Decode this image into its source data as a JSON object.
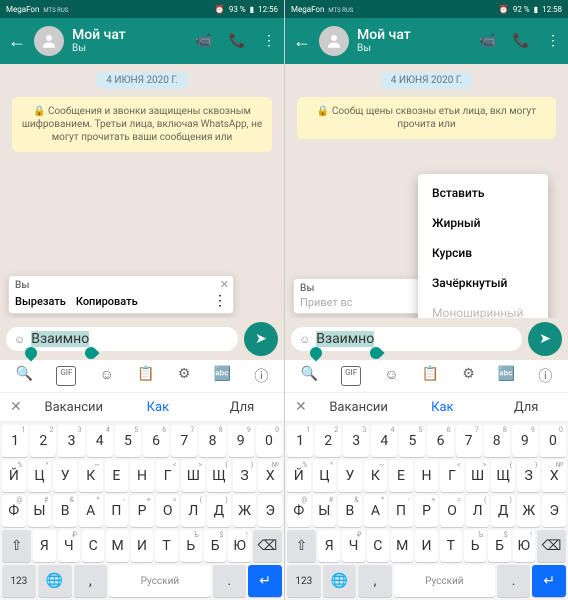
{
  "left": {
    "status": {
      "carrier": "MegaFon",
      "sub": "MTS RUS",
      "battery": "93 %",
      "time": "12:56"
    },
    "header": {
      "title": "Мой чат",
      "sub": "Вы"
    },
    "date": "4 ИЮНЯ 2020 Г.",
    "enc": "🔒 Сообщения и звонки защищены сквозным шифрованием. Третьи лица, включая WhatsApp, не могут прочитать ваши сообщения или",
    "reply": {
      "who": "Вы",
      "cut": "Вырезать",
      "copy": "Копировать"
    },
    "input": "Взаимно"
  },
  "right": {
    "status": {
      "carrier": "MegaFon",
      "sub": "MTS RUS",
      "battery": "92 %",
      "time": "12:58"
    },
    "header": {
      "title": "Мой чат",
      "sub": "Вы"
    },
    "date": "4 ИЮНЯ 2020 Г.",
    "enc": "🔒 Сообщ                               щены сквозны                          етьи лица, вкл                           могут прочита                          или",
    "menu": [
      "Вставить",
      "Жирный",
      "Курсив",
      "Зачёркнутый",
      "Моноширинный"
    ],
    "reply": {
      "who": "Вы",
      "ghost": "Привет вс"
    },
    "input": "Взаимно"
  },
  "suggest": {
    "s1": "Вакансии",
    "s2": "Как",
    "s3": "Для"
  },
  "keyboard": {
    "numrow": [
      [
        "1",
        "1"
      ],
      [
        "2",
        "2"
      ],
      [
        "3",
        "3"
      ],
      [
        "4",
        "4"
      ],
      [
        "5",
        "5"
      ],
      [
        "6",
        "6"
      ],
      [
        "7",
        "7"
      ],
      [
        "8",
        "8"
      ],
      [
        "9",
        "9"
      ],
      [
        "0",
        "0"
      ]
    ],
    "row1": [
      [
        "Й",
        "%"
      ],
      [
        "Ц",
        "^"
      ],
      [
        "У",
        ""
      ],
      [
        "К",
        "~"
      ],
      [
        "Е",
        ""
      ],
      [
        "Н",
        ""
      ],
      [
        "Г",
        "<"
      ],
      [
        "Ш",
        ">"
      ],
      [
        "Щ",
        "{"
      ],
      [
        "З",
        "}"
      ],
      [
        "Х",
        "№"
      ]
    ],
    "row2": [
      [
        "Ф",
        "@"
      ],
      [
        "Ы",
        "#"
      ],
      [
        "В",
        "&"
      ],
      [
        "А",
        "*"
      ],
      [
        "П",
        "-"
      ],
      [
        "Р",
        "+"
      ],
      [
        "О",
        "="
      ],
      [
        "Л",
        "("
      ],
      [
        "Д",
        ")"
      ],
      [
        "Ж",
        ""
      ],
      [
        "Э",
        ""
      ]
    ],
    "row3": [
      [
        "Я",
        ""
      ],
      [
        "Ч",
        "₽"
      ],
      [
        "С",
        ""
      ],
      [
        "М",
        ""
      ],
      [
        "И",
        ""
      ],
      [
        "Т",
        ""
      ],
      [
        "Ь",
        "Ъ"
      ],
      [
        "Б",
        "$"
      ],
      [
        "Ю",
        "!"
      ]
    ],
    "shift": "⇧",
    "back": "⌫",
    "num": "123",
    "lang": "Русский",
    "enter": "↵"
  }
}
